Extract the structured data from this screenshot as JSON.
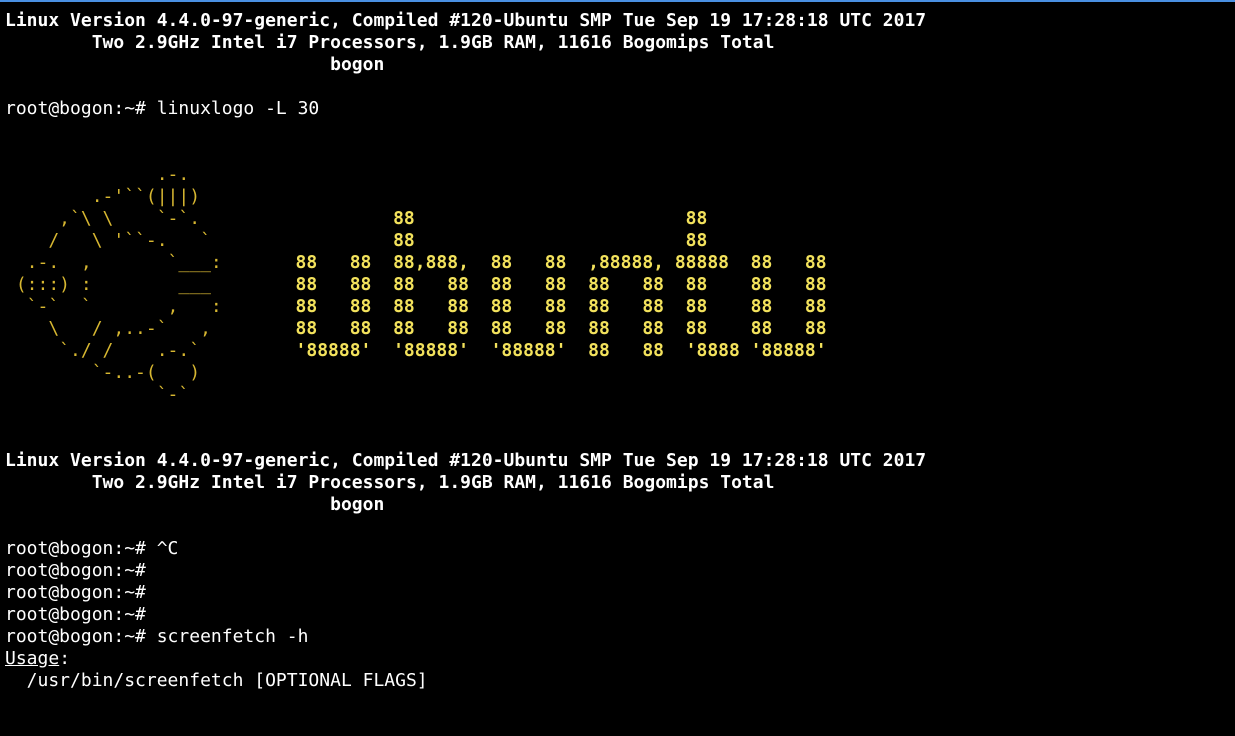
{
  "colors": {
    "background": "#000000",
    "text": "#ffffff",
    "logo_text": "#f3e25c",
    "penguin": "#d7b731",
    "top_border": "#4a90e2"
  },
  "header1": {
    "version": "Linux Version 4.4.0-97-generic, Compiled #120-Ubuntu SMP Tue Sep 19 17:28:18 UTC 2017",
    "hardware": "        Two 2.9GHz Intel i7 Processors, 1.9GB RAM, 11616 Bogomips Total",
    "hostname": "                              bogon"
  },
  "command1": "root@bogon:~# linuxlogo -L 30",
  "ascii_logo": {
    "penguin": [
      "              .-.",
      "        .-'``(|||)",
      "     ,`\\ \\    `-`.",
      "    /   \\ '``-.   `",
      "  .-.  ,       `___:",
      " (:::) :        ___",
      "  `-`  `       ,   :",
      "    \\   / ,..-`   ,",
      "     `./ /    .-.`",
      "        `-..-(   )",
      "              `-`"
    ],
    "word": [
      "",
      "",
      "                  88                         88",
      "                  88                         88",
      "         88   88  88,888,  88   88  ,88888, 88888  88   88",
      "         88   88  88   88  88   88  88   88  88    88   88",
      "         88   88  88   88  88   88  88   88  88    88   88",
      "         88   88  88   88  88   88  88   88  88    88   88",
      "         '88888'  '88888'  '88888'  88   88  '8888 '88888'",
      "",
      ""
    ]
  },
  "header2": {
    "version": "Linux Version 4.4.0-97-generic, Compiled #120-Ubuntu SMP Tue Sep 19 17:28:18 UTC 2017",
    "hardware": "        Two 2.9GHz Intel i7 Processors, 1.9GB RAM, 11616 Bogomips Total",
    "hostname": "                              bogon"
  },
  "prompts": [
    "root@bogon:~# ^C",
    "root@bogon:~#",
    "root@bogon:~#",
    "root@bogon:~#",
    "root@bogon:~# screenfetch -h"
  ],
  "usage": {
    "label": "Usage",
    "colon": ":",
    "command": "  /usr/bin/screenfetch [OPTIONAL FLAGS]"
  }
}
